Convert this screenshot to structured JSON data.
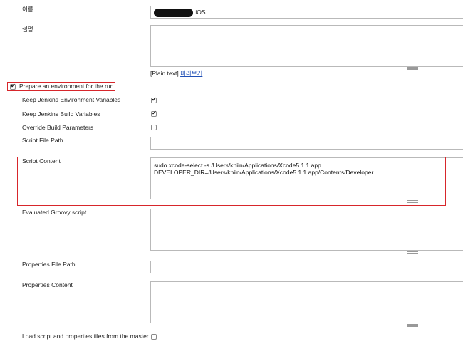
{
  "colors": {
    "highlight": "#d7262b",
    "link": "#1f4fb5",
    "border": "#b9b9b9"
  },
  "name_field": {
    "label": "이름",
    "value_suffix": ".iOS",
    "redacted": true
  },
  "description_field": {
    "label": "설명",
    "value": "",
    "format_note": "[Plain text]",
    "preview_link": "미리보기"
  },
  "env_injector": {
    "prepare_label": "Prepare an environment for the run",
    "prepare_checked": true,
    "options": [
      {
        "label": "Keep Jenkins Environment Variables",
        "checked": true
      },
      {
        "label": "Keep Jenkins Build Variables",
        "checked": true
      },
      {
        "label": "Override Build Parameters",
        "checked": false
      }
    ],
    "script_file_path": {
      "label": "Script File Path",
      "value": ""
    },
    "script_content": {
      "label": "Script Content",
      "lines": [
        "sudo xcode-select -s /Users/khiin/Applications/Xcode5.1.1.app",
        "DEVELOPER_DIR=/Users/khiin/Applications/Xcode5.1.1.app/Contents/Developer"
      ]
    },
    "groovy_script": {
      "label": "Evaluated Groovy script",
      "value": ""
    },
    "properties_file_path": {
      "label": "Properties File Path",
      "value": ""
    },
    "properties_content": {
      "label": "Properties Content",
      "value": ""
    },
    "load_from_master": {
      "label": "Load script and properties files from the master",
      "checked": false
    }
  },
  "icons": {
    "checkmark": "check-icon",
    "resize": "resize-grip-icon"
  }
}
